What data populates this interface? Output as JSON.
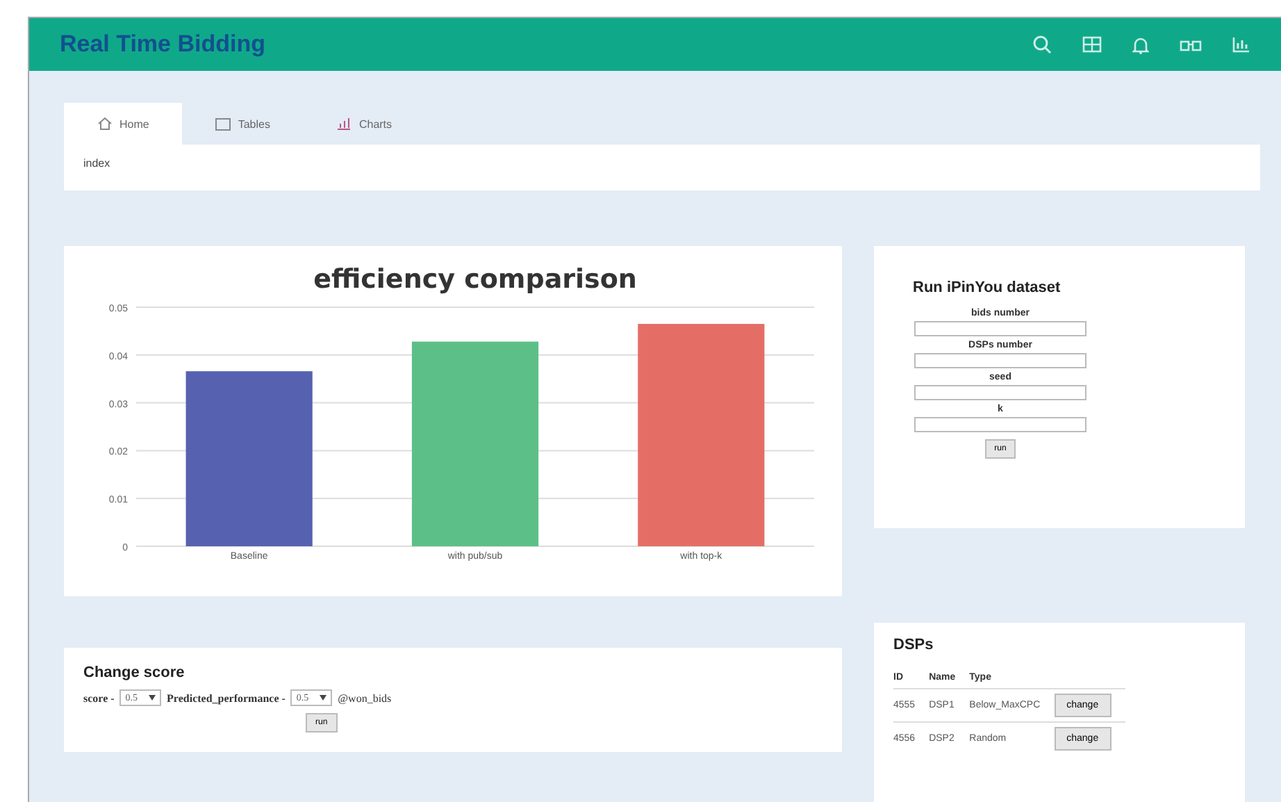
{
  "header": {
    "title": "Real Time Bidding",
    "icons": [
      {
        "kind": "search"
      },
      {
        "kind": "grid"
      },
      {
        "kind": "bell"
      },
      {
        "kind": "glasses"
      },
      {
        "kind": "chart"
      }
    ]
  },
  "tabs": [
    {
      "label": "Home",
      "kind": "home",
      "selected": true
    },
    {
      "label": "Tables",
      "kind": "table",
      "selected": false
    },
    {
      "label": "Charts",
      "kind": "chart",
      "selected": false
    }
  ],
  "tab_content": "index",
  "chart": {
    "chart_data": {
      "type": "bar",
      "title": "efficiency comparison",
      "categories": [
        "Baseline",
        "with pub/sub",
        "with top-k"
      ],
      "series": [
        {
          "values": [
            0.0366,
            0.0428,
            0.0465
          ]
        }
      ],
      "grid": true,
      "colors": [
        "#5662b0",
        "#5cbf88",
        "#e46e66"
      ],
      "ylim": [
        0,
        0.05
      ],
      "yticks": [
        0,
        0.01,
        0.02,
        0.03,
        0.04,
        0.05
      ]
    }
  },
  "run_form": {
    "title": "Run iPinYou dataset",
    "fields": [
      {
        "label": "bids number"
      },
      {
        "label": "DSPs number"
      },
      {
        "label": "seed"
      },
      {
        "label": "k"
      }
    ],
    "button": "run"
  },
  "change_score": {
    "title": "Change score",
    "label_1": "score -",
    "select_1": "0.5",
    "label_2": "Predicted_performance -",
    "select_2": "0.5",
    "label_3": "@won_bids",
    "button": "run"
  },
  "dsps": {
    "title": "DSPs",
    "columns": [
      "ID",
      "Name",
      "Type"
    ],
    "rows": [
      {
        "id": "4555",
        "name": "DSP1",
        "type": "Below_MaxCPC",
        "button": "change"
      },
      {
        "id": "4556",
        "name": "DSP2",
        "type": "Random",
        "button": "change"
      }
    ]
  }
}
